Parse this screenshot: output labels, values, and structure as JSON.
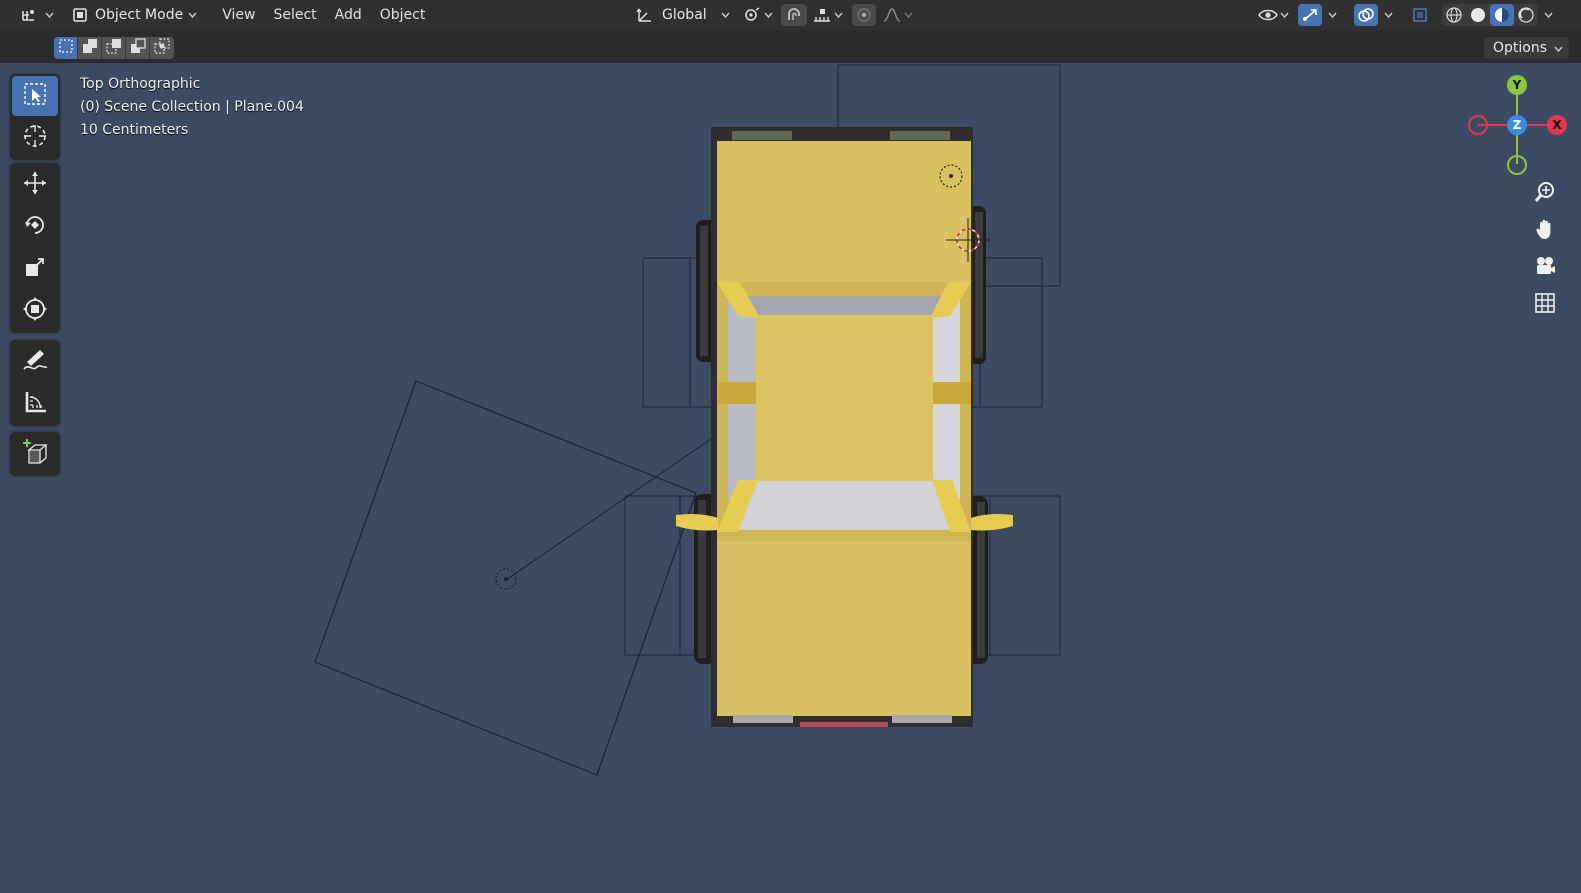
{
  "header": {
    "mode_label": "Object Mode",
    "menus": [
      "View",
      "Select",
      "Add",
      "Object"
    ],
    "transform_orientation": "Global"
  },
  "subbar": {
    "options_label": "Options"
  },
  "viewport": {
    "view_name": "Top Orthographic",
    "collection_line": "(0) Scene Collection | Plane.004",
    "scale_line": "10 Centimeters"
  },
  "gizmo": {
    "y_label": "Y",
    "z_label": "Z",
    "x_label": "X",
    "colors": {
      "x": "#e0394e",
      "y": "#8bc53f",
      "z": "#3c8ae6"
    }
  },
  "colors": {
    "accent": "#4772b3",
    "viewport_bg": "#3d4b62",
    "car_body": "#d9c15f",
    "cab_glass": "#b8bcc4"
  },
  "icons": {
    "editor_type": "transform-editor-icon",
    "select_box": "select-box-icon",
    "cursor": "cursor-icon",
    "move": "move-icon",
    "rotate": "rotate-icon",
    "scale": "scale-icon",
    "transform": "transform-icon",
    "annotate": "annotate-icon",
    "measure": "measure-icon",
    "add_cube": "add-cube-icon",
    "zoom": "zoom-icon",
    "pan": "hand-icon",
    "camera": "camera-icon",
    "grid": "grid-icon"
  }
}
